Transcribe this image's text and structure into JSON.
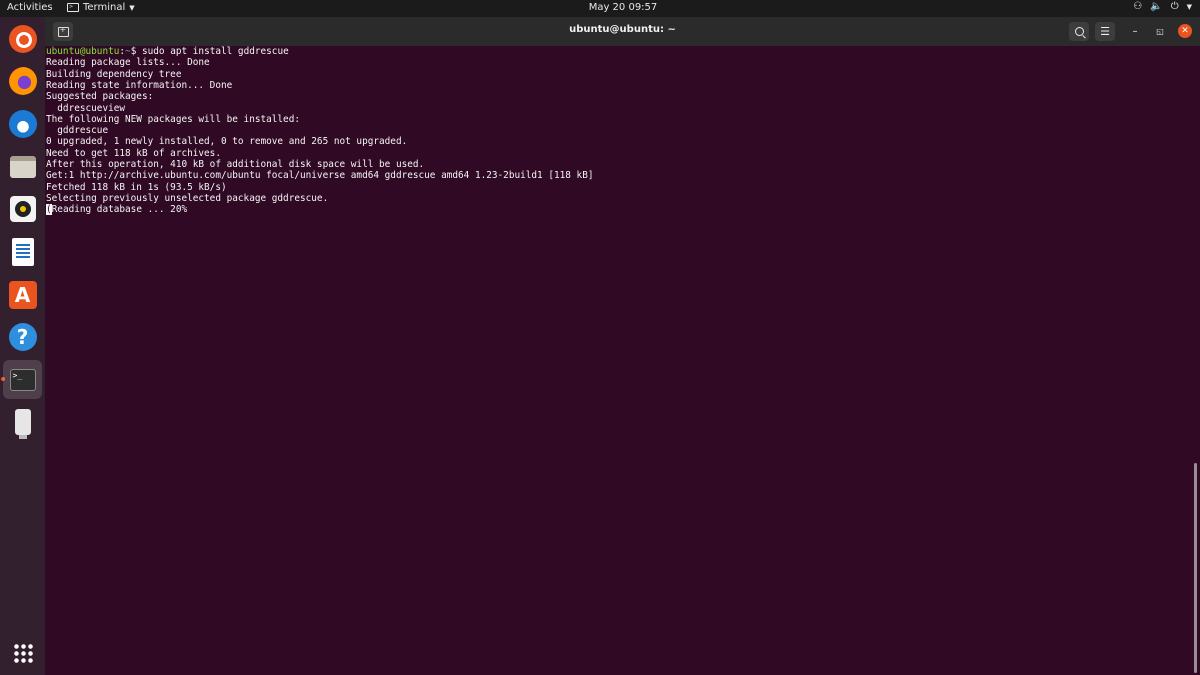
{
  "topbar": {
    "activities": "Activities",
    "app_name": "Terminal",
    "clock": "May 20  09:57",
    "status_icons": [
      "network-icon",
      "volume-icon",
      "power-icon"
    ]
  },
  "dock": {
    "items": [
      {
        "name": "ubuntu-installer",
        "icon": "ubuntu-icon"
      },
      {
        "name": "firefox",
        "icon": "firefox-icon"
      },
      {
        "name": "thunderbird",
        "icon": "thunderbird-icon"
      },
      {
        "name": "files",
        "icon": "files-icon"
      },
      {
        "name": "rhythmbox",
        "icon": "rhythmbox-icon"
      },
      {
        "name": "libreoffice-writer",
        "icon": "writer-icon"
      },
      {
        "name": "ubuntu-software",
        "icon": "software-icon"
      },
      {
        "name": "help",
        "icon": "help-icon"
      },
      {
        "name": "terminal",
        "icon": "terminal-icon",
        "active": true
      },
      {
        "name": "usb-drive",
        "icon": "usb-drive-icon"
      }
    ],
    "show_apps_icon": "app-grid-icon",
    "store_glyph": "A",
    "help_glyph": "?",
    "terminal_glyph": ">_"
  },
  "window": {
    "title": "ubuntu@ubuntu: ~",
    "colors": {
      "background": "#300a24",
      "prompt_user": "#8ae234",
      "prompt_path": "#729fcf",
      "accent": "#e95420"
    }
  },
  "terminal": {
    "prompt_user": "ubuntu@ubuntu",
    "prompt_sep": ":",
    "prompt_path": "~",
    "prompt_end": "$ ",
    "command": "sudo apt install gddrescue",
    "output": [
      "Reading package lists... Done",
      "Building dependency tree",
      "Reading state information... Done",
      "Suggested packages:",
      "  ddrescueview",
      "The following NEW packages will be installed:",
      "  gddrescue",
      "0 upgraded, 1 newly installed, 0 to remove and 265 not upgraded.",
      "Need to get 118 kB of archives.",
      "After this operation, 410 kB of additional disk space will be used.",
      "Get:1 http://archive.ubuntu.com/ubuntu focal/universe amd64 gddrescue amd64 1.23-2build1 [118 kB]",
      "Fetched 118 kB in 1s (93.5 kB/s)",
      "Selecting previously unselected package gddrescue."
    ],
    "cursor_char": "(",
    "last_line": "Reading database ... 20%"
  }
}
